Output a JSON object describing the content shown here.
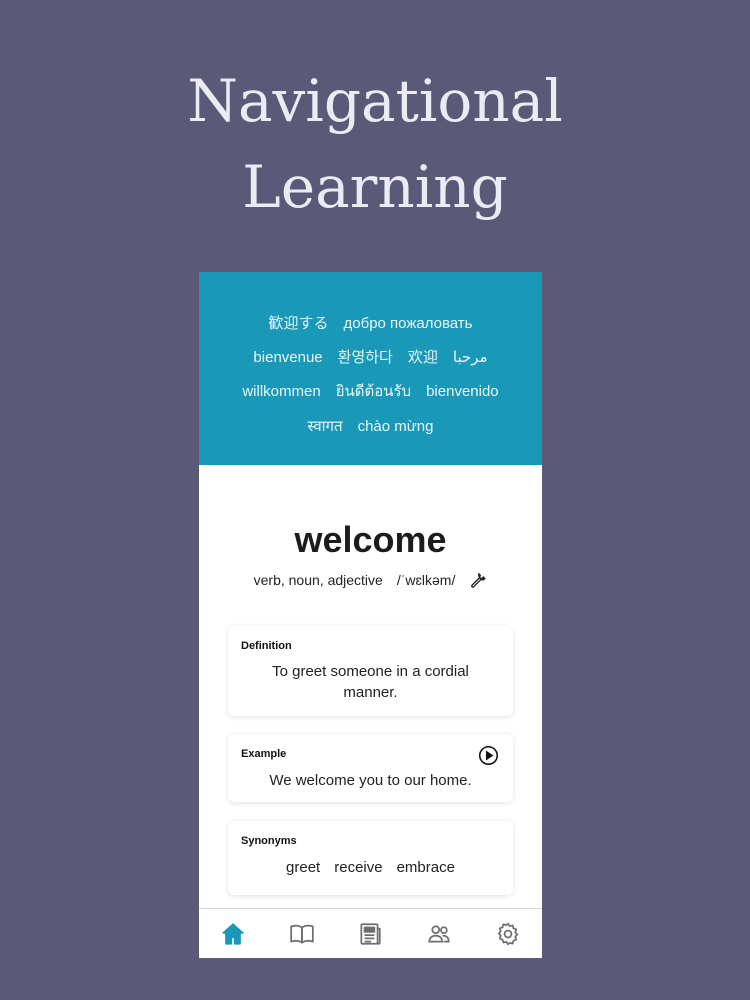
{
  "headline": {
    "line1": "Navigational",
    "line2": "Learning"
  },
  "greetings": {
    "row1": [
      "歓迎する",
      "добро пожаловать"
    ],
    "row2": [
      "bienvenue",
      "환영하다",
      "欢迎",
      "مرحبا"
    ],
    "row3": [
      "willkommen",
      "ยินดีต้อนรับ",
      "bienvenido"
    ],
    "row4": [
      "स्वागत",
      "chào mừng"
    ]
  },
  "word": {
    "title": "welcome",
    "parts_of_speech": "verb, noun, adjective",
    "pronunciation": "/ˈwɛlkəm/",
    "tool_icon": "wrench-icon"
  },
  "definition": {
    "label": "Definition",
    "text": "To greet someone in a cordial manner."
  },
  "example": {
    "label": "Example",
    "text": "We welcome you to our home.",
    "icon": "play-icon"
  },
  "synonyms": {
    "label": "Synonyms",
    "items": [
      "greet",
      "receive",
      "embrace"
    ]
  },
  "tabbar": {
    "tabs": [
      {
        "icon": "home-icon",
        "active": true
      },
      {
        "icon": "book-icon",
        "active": false
      },
      {
        "icon": "news-icon",
        "active": false
      },
      {
        "icon": "people-icon",
        "active": false
      },
      {
        "icon": "gear-icon",
        "active": false
      }
    ]
  },
  "colors": {
    "background": "#5a5a78",
    "banner": "#1a98b8",
    "accent": "#1a98b8",
    "inactive_icon": "#6e6e6e"
  }
}
